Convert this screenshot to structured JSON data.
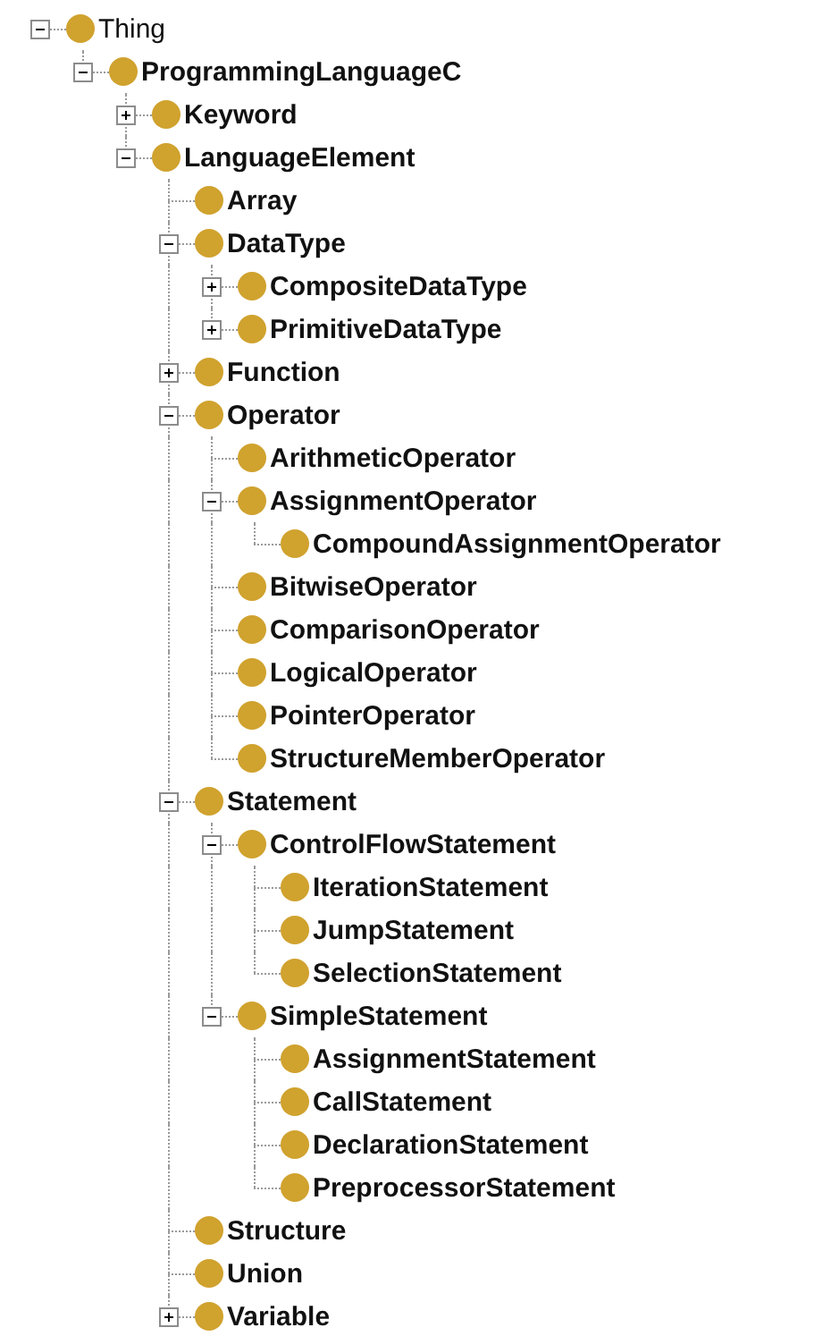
{
  "tree": [
    {
      "label": "Thing",
      "bold": false,
      "expanded": true,
      "children": [
        {
          "label": "ProgrammingLanguageC",
          "bold": true,
          "expanded": true,
          "children": [
            {
              "label": "Keyword",
              "bold": true,
              "expanded": false
            },
            {
              "label": "LanguageElement",
              "bold": true,
              "expanded": true,
              "children": [
                {
                  "label": "Array",
                  "bold": true
                },
                {
                  "label": "DataType",
                  "bold": true,
                  "expanded": true,
                  "children": [
                    {
                      "label": "CompositeDataType",
                      "bold": true,
                      "expanded": false
                    },
                    {
                      "label": "PrimitiveDataType",
                      "bold": true,
                      "expanded": false
                    }
                  ]
                },
                {
                  "label": "Function",
                  "bold": true,
                  "expanded": false
                },
                {
                  "label": "Operator",
                  "bold": true,
                  "expanded": true,
                  "children": [
                    {
                      "label": "ArithmeticOperator",
                      "bold": true
                    },
                    {
                      "label": "AssignmentOperator",
                      "bold": true,
                      "expanded": true,
                      "children": [
                        {
                          "label": "CompoundAssignmentOperator",
                          "bold": true
                        }
                      ]
                    },
                    {
                      "label": "BitwiseOperator",
                      "bold": true
                    },
                    {
                      "label": "ComparisonOperator",
                      "bold": true
                    },
                    {
                      "label": "LogicalOperator",
                      "bold": true
                    },
                    {
                      "label": "PointerOperator",
                      "bold": true
                    },
                    {
                      "label": "StructureMemberOperator",
                      "bold": true
                    }
                  ]
                },
                {
                  "label": "Statement",
                  "bold": true,
                  "expanded": true,
                  "children": [
                    {
                      "label": "ControlFlowStatement",
                      "bold": true,
                      "expanded": true,
                      "children": [
                        {
                          "label": "IterationStatement",
                          "bold": true
                        },
                        {
                          "label": "JumpStatement",
                          "bold": true
                        },
                        {
                          "label": "SelectionStatement",
                          "bold": true
                        }
                      ]
                    },
                    {
                      "label": "SimpleStatement",
                      "bold": true,
                      "expanded": true,
                      "children": [
                        {
                          "label": "AssignmentStatement",
                          "bold": true
                        },
                        {
                          "label": "CallStatement",
                          "bold": true
                        },
                        {
                          "label": "DeclarationStatement",
                          "bold": true
                        },
                        {
                          "label": "PreprocessorStatement",
                          "bold": true
                        }
                      ]
                    }
                  ]
                },
                {
                  "label": "Structure",
                  "bold": true
                },
                {
                  "label": "Union",
                  "bold": true
                },
                {
                  "label": "Variable",
                  "bold": true,
                  "expanded": false
                }
              ]
            }
          ]
        }
      ]
    }
  ]
}
